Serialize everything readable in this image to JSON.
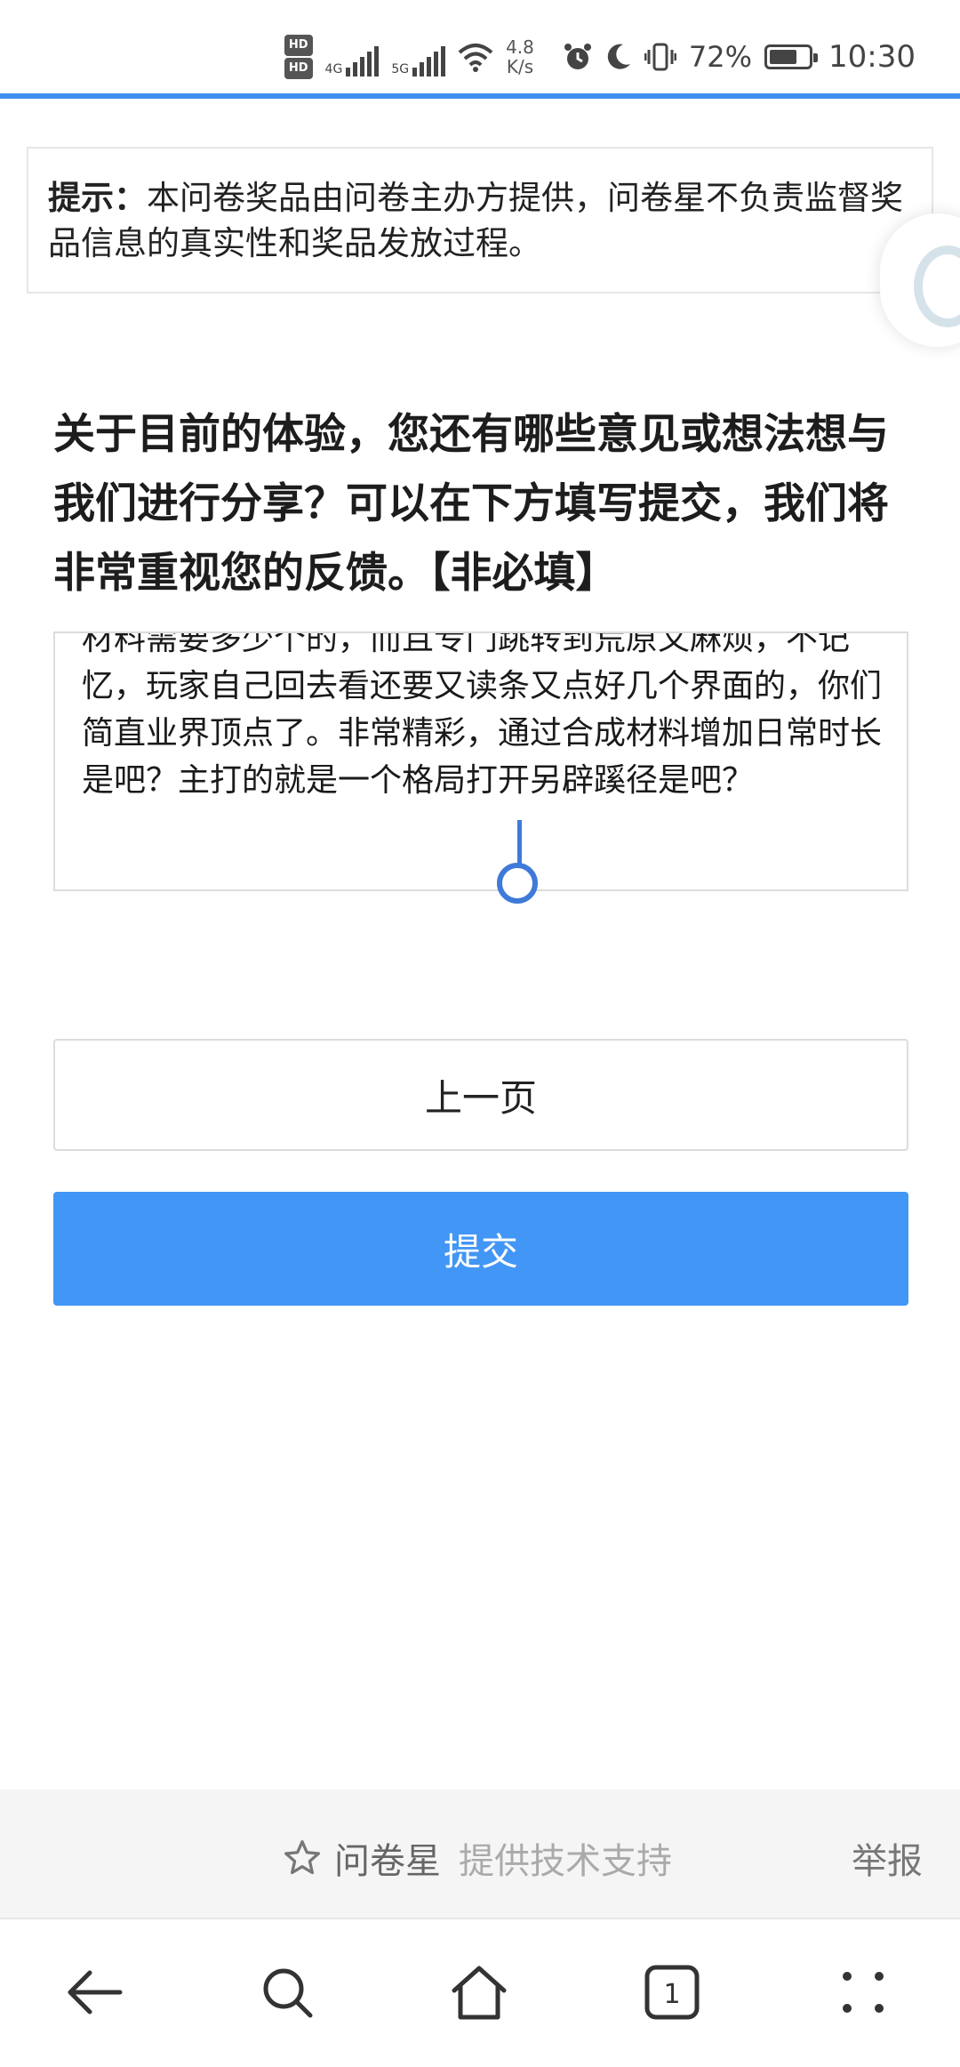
{
  "status_bar": {
    "hd1": "HD",
    "hd2": "HD",
    "net1": "4G",
    "net2": "5G",
    "speed_value": "4.8",
    "speed_unit": "K/s",
    "battery": "72%",
    "battery_level": 0.72,
    "time": "10:30"
  },
  "hint": {
    "label": "提示：",
    "text": "本问卷奖品由问卷主办方提供，问卷星不负责监督奖品信息的真实性和奖品发放过程。"
  },
  "question": {
    "text": "关于目前的体验，您还有哪些意见或想法想与我们进行分享？可以在下方填写提交，我们将非常重视您的反馈。【非必填】"
  },
  "answer": {
    "text": "材料需要多少个的，而且专门跳转到荒原又麻烦，不记忆，玩家自己回去看还要又读条又点好几个界面的，你们简直业界顶点了。非常精彩，通过合成材料增加日常时长是吧？主打的就是一个格局打开另辟蹊径是吧？"
  },
  "buttons": {
    "prev": "上一页",
    "submit": "提交"
  },
  "footer": {
    "brand": "问卷星",
    "support": "提供技术支持",
    "report": "举报"
  },
  "nav": {
    "tab_count": "1"
  },
  "colors": {
    "accent": "#4296f5",
    "top_line": "#3f8ef0"
  }
}
